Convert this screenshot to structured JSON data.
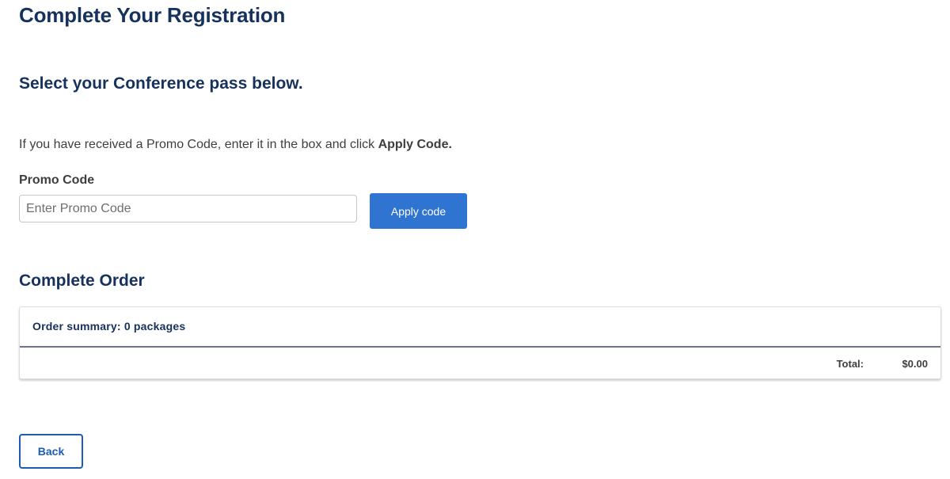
{
  "page": {
    "title": "Complete Your Registration"
  },
  "pass_section": {
    "title": "Select your Conference pass below.",
    "instructions_prefix": "If you have received a Promo Code, enter it in the box and click ",
    "instructions_emphasis": "Apply Code."
  },
  "promo": {
    "label": "Promo Code",
    "value": "",
    "placeholder": "Enter Promo Code",
    "apply_label": "Apply code"
  },
  "order": {
    "title": "Complete Order",
    "summary": "Order summary: 0 packages",
    "total_label": "Total:",
    "total_value": "$0.00"
  },
  "navigation": {
    "back_label": "Back"
  },
  "colors": {
    "heading": "#16325c",
    "primary_button": "#2e74d0",
    "back_button": "#1b5cb5",
    "body_text": "#3e3e3c",
    "divider": "#6b7391"
  }
}
